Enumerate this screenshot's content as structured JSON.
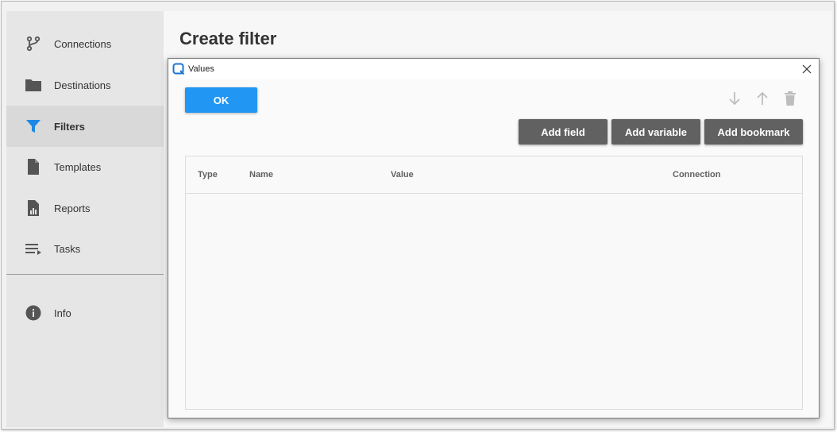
{
  "sidebar": {
    "items": [
      {
        "label": "Connections",
        "icon": "source-branch-icon"
      },
      {
        "label": "Destinations",
        "icon": "folder-icon"
      },
      {
        "label": "Filters",
        "icon": "filter-icon",
        "active": true
      },
      {
        "label": "Templates",
        "icon": "file-icon"
      },
      {
        "label": "Reports",
        "icon": "report-icon"
      },
      {
        "label": "Tasks",
        "icon": "task-list-icon"
      }
    ],
    "info": {
      "label": "Info",
      "icon": "info-icon"
    }
  },
  "main": {
    "title": "Create filter"
  },
  "dialog": {
    "title": "Values",
    "ok_label": "OK",
    "toolbar": {
      "move_down": "arrow-down-icon",
      "move_up": "arrow-up-icon",
      "delete": "trash-icon"
    },
    "buttons": {
      "add_field": "Add field",
      "add_variable": "Add variable",
      "add_bookmark": "Add bookmark"
    },
    "table": {
      "columns": [
        "Type",
        "Name",
        "Value",
        "Connection"
      ],
      "rows": []
    }
  },
  "colors": {
    "accent": "#2196f3",
    "filter_icon": "#1e88e5",
    "action_button": "#616161",
    "icon_gray": "#555555",
    "disabled_icon": "#bdbdbd"
  }
}
